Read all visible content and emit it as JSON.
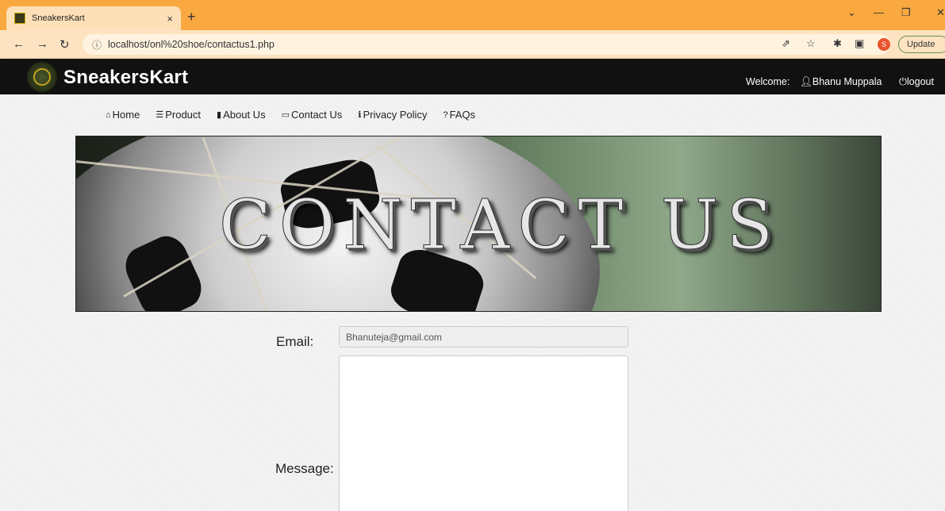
{
  "browser": {
    "tab_title": "SneakersKart",
    "tab_close": "×",
    "new_tab": "+",
    "url": "localhost/onl%20shoe/contactus1.php",
    "update_label": "Update",
    "profile_initial": "S"
  },
  "header": {
    "brand": "SneakersKart",
    "welcome_label": "Welcome:",
    "user_name": "Bhanu Muppala",
    "logout_label": "logout"
  },
  "nav": {
    "items": [
      {
        "label": "Home",
        "icon": "home-icon",
        "glyph": "⌂"
      },
      {
        "label": "Product",
        "icon": "list-icon",
        "glyph": "☰"
      },
      {
        "label": "About Us",
        "icon": "bookmark-icon",
        "glyph": "▮"
      },
      {
        "label": "Contact Us",
        "icon": "comment-icon",
        "glyph": "▭"
      },
      {
        "label": "Privacy Policy",
        "icon": "info-icon",
        "glyph": "ℹ"
      },
      {
        "label": "FAQs",
        "icon": "question-icon",
        "glyph": "?"
      }
    ]
  },
  "banner": {
    "text": "CONTACT US"
  },
  "form": {
    "email_label": "Email:",
    "email_value": "Bhanuteja@gmail.com",
    "message_label": "Message:",
    "message_value": ""
  },
  "colors": {
    "tabbar": "#f9a940",
    "header": "#111111"
  }
}
